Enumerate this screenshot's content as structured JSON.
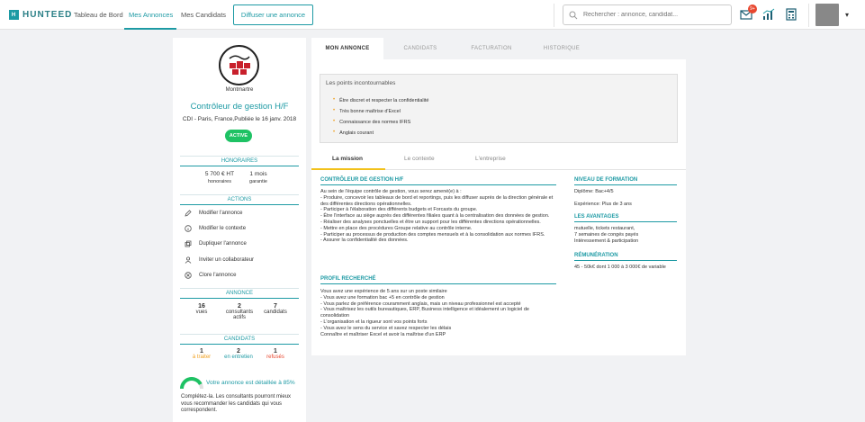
{
  "nav": {
    "logo_mark": "H",
    "brand": "HUNTEED",
    "links": [
      "Tableau de Bord",
      "Mes Annonces",
      "Mes Candidats"
    ],
    "cta": "Diffuser une annonce",
    "search_placeholder": "Rechercher : annonce, candidat...",
    "notif_count": "9+",
    "caret": "▾"
  },
  "sidebar": {
    "company": "Montmartre",
    "job_title": "Contrôleur de gestion H/F",
    "meta": "CDI - Paris, France,Publiée le 16 janv. 2018",
    "status": "ACTIVE",
    "honoraires": {
      "head": "HONORAIRES",
      "fee": "5 700 € HT",
      "fee_label": "honoraires",
      "guarantee": "1 mois",
      "guarantee_label": "garantie"
    },
    "actions": {
      "head": "ACTIONS",
      "items": [
        "Modifier l'annonce",
        "Modifier le contexte",
        "Dupliquer l'annonce",
        "Inviter un collaborateur",
        "Clore l'annonce"
      ]
    },
    "annonce": {
      "head": "ANNONCE",
      "stats": [
        {
          "n": "16",
          "l": "vues"
        },
        {
          "n": "2",
          "l": "consultants actifs"
        },
        {
          "n": "7",
          "l": "candidats"
        }
      ]
    },
    "candidats": {
      "head": "CANDIDATS",
      "stats": [
        {
          "n": "1",
          "l": "à traiter",
          "color": "#f0a020"
        },
        {
          "n": "2",
          "l": "en entretien",
          "color": "#1d9aa4"
        },
        {
          "n": "1",
          "l": "refusés",
          "color": "#e8472f"
        }
      ]
    },
    "detail": {
      "title": "Votre annonce est détaillée à 85%",
      "percent": 85,
      "text": "Complétez-la. Les consultants pourront mieux vous recommander les candidats qui vous correspondent."
    }
  },
  "tabs": [
    "MON ANNONCE",
    "CANDIDATS",
    "FACTURATION",
    "HISTORIQUE"
  ],
  "highlights": {
    "title": "Les points incontournables",
    "items": [
      "Être discret et respecter la confidentialité",
      "Très bonne maîtrise d'Excel",
      "Connaissance des normes IFRS",
      "Anglais courant"
    ]
  },
  "subtabs": [
    "La mission",
    "Le contexte",
    "L'entreprise"
  ],
  "mission": {
    "poste_head": "CONTRÔLEUR DE GESTION H/F",
    "poste_text": "Au sein de l'équipe contrôle de gestion, vous serez amené(e) à :\n-      Produire, concevoir les tableaux de bord et reportings, puis les diffuser auprès de la direction générale et des différentes directions opérationnelles.\n-      Participer à l'élaboration des différents budgets et Forcasts du groupe.\n-      Être l'interface au siège auprès des différentes filiales quant à la centralisation des données de gestion.\n-      Réaliser des analyses ponctuelles et être un support pour les différentes directions opérationnelles.\n-      Mettre en place des procédures Groupe relative au contrôle interne.\n-      Participer au processus de production des comptes mensuels et à la consolidation aux normes IFRS.\n-      Assurer la confidentialité des données.",
    "profil_head": "PROFIL RECHERCHÉ",
    "profil_text": "Vous avez une expérience de 5 ans sur un poste similaire\n-      Vous avez une formation bac +5 en contrôle de gestion\n-      Vous parlez de préférence couramment anglais, mais un niveau professionnel est accepté\n-      Vous maîtrisez les outils bureautiques, ERP, Business intelligence et idéalement un logiciel de consolidation\n-      L'organisation et la rigueur sont vos points forts\n-      Vous avez le sens du service et savez respecter les délais\nConnaître et maîtriser Excel et avoir la maîtrise d'un ERP",
    "formation_head": "NIVEAU DE FORMATION",
    "formation_text": "Diplôme: Bac+4/5\n\nExpérience: Plus de 3 ans",
    "avantages_head": "LES AVANTAGES",
    "avantages_text": "mutuelle, tickets restaurant,\n7 semaines de congés payés\nIntéressement & participation",
    "remuneration_head": "RÉMUNÉRATION",
    "remuneration_text": "45 - 50k€ dont 1 000 à 3 000€ de variable"
  },
  "colors": {
    "accent": "#1d9aa4",
    "active": "#1ec264",
    "warning": "#f0a020",
    "danger": "#e8472f"
  }
}
